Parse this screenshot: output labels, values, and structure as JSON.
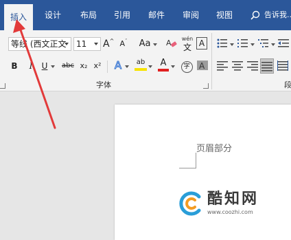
{
  "tabs": [
    "插入",
    "设计",
    "布局",
    "引用",
    "邮件",
    "审阅",
    "视图"
  ],
  "tell_me": "告诉我...",
  "font": {
    "name": "等线 (西文正文",
    "size": "11",
    "grow_label": "A",
    "shrink_label": "A",
    "case_label": "Aa",
    "phonetic_top": "wén",
    "phonetic_bottom": "文",
    "border_char_label": "A",
    "bold": "B",
    "italic": "I",
    "underline": "U",
    "strikethrough": "abc",
    "subscript": "x₂",
    "superscript": "x²",
    "text_effect": "A",
    "highlight": "ab",
    "font_color": "A",
    "enclose_char": "字",
    "group_label": "字体"
  },
  "paragraph": {
    "group_label_partial": "段"
  },
  "document": {
    "header_text": "页眉部分"
  },
  "watermark": {
    "title": "酷知网",
    "url": "www.coozhi.com"
  },
  "colors": {
    "tab_bar": "#2b579a",
    "ribbon_bg": "#f3f3f3",
    "annotation_arrow": "#e23a3a",
    "font_color_bar": "#e02020",
    "highlight_bar": "#f7e300"
  }
}
